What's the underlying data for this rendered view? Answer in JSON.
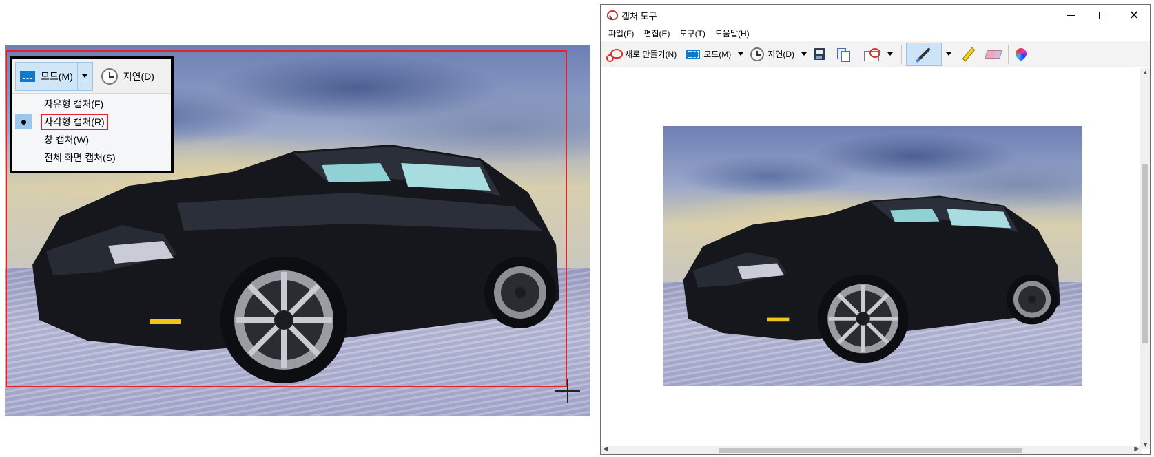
{
  "left_panel": {
    "mode_button_label": "모드(M)",
    "delay_button_label": "지연(D)",
    "mode_menu": [
      {
        "label": "자유형 캡처(F)",
        "checked": false,
        "highlighted": false
      },
      {
        "label": "사각형 캡처(R)",
        "checked": true,
        "highlighted": true
      },
      {
        "label": "창 캡처(W)",
        "checked": false,
        "highlighted": false
      },
      {
        "label": "전체 화면 캡처(S)",
        "checked": false,
        "highlighted": false
      }
    ],
    "selection_color": "#e0242a"
  },
  "window": {
    "title": "캡처 도구",
    "menu_bar": [
      "파일(F)",
      "편집(E)",
      "도구(T)",
      "도움말(H)"
    ],
    "toolbar": {
      "new_label": "새로 만들기(N)",
      "mode_label": "모드(M)",
      "delay_label": "지연(D)"
    }
  },
  "icons": {
    "app": "snipping-tool-icon",
    "new": "scissors-icon",
    "mode": "rectangle-mode-icon",
    "delay": "clock-icon",
    "save": "save-icon",
    "copy": "copy-icon",
    "send": "send-snip-icon",
    "pen": "pen-icon",
    "highlighter": "highlighter-icon",
    "eraser": "eraser-icon",
    "color": "paint3d-icon"
  },
  "image_content": "black-sports-car-on-snow"
}
